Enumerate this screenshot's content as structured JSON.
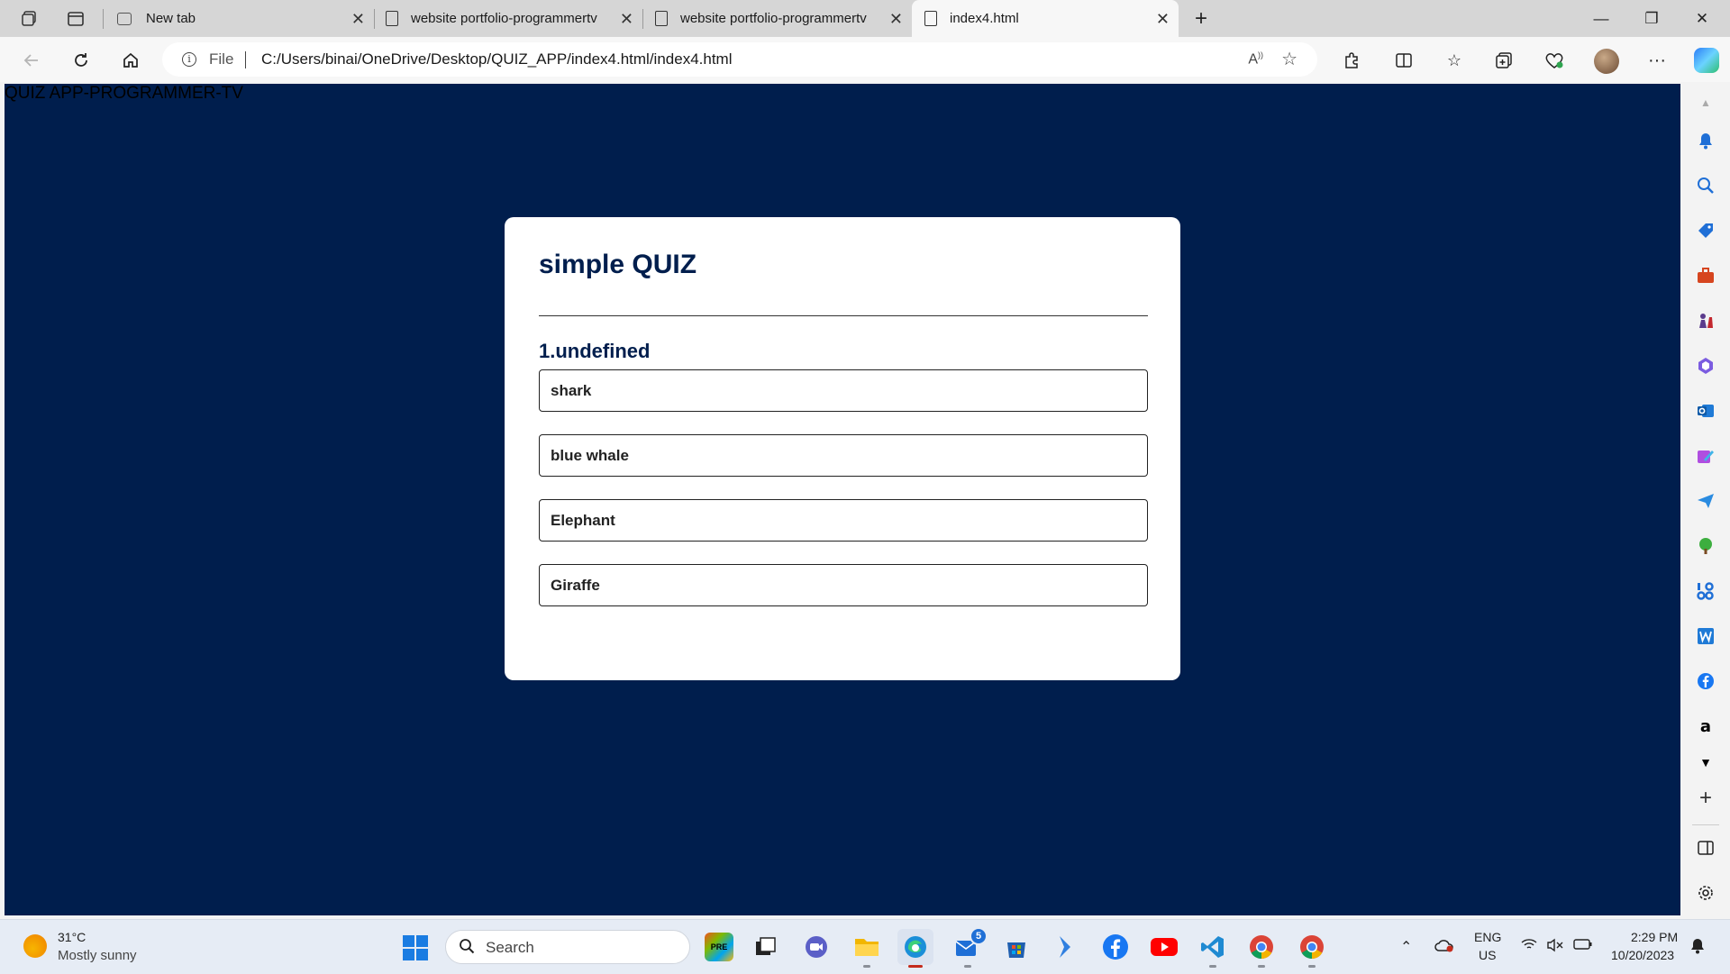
{
  "browser": {
    "tabs": [
      {
        "label": "New tab",
        "kind": "newtab",
        "active": false
      },
      {
        "label": "website portfolio-programmertv",
        "kind": "page",
        "active": false
      },
      {
        "label": "website portfolio-programmertv",
        "kind": "page",
        "active": false
      },
      {
        "label": "index4.html",
        "kind": "page",
        "active": true
      }
    ],
    "new_tab_symbol": "+",
    "window_controls": {
      "minimize": "—",
      "restore": "❐",
      "close": "✕"
    },
    "address": {
      "scheme": "File",
      "url": "C:/Users/binai/OneDrive/Desktop/QUIZ_APP/index4.html/index4.html"
    }
  },
  "page": {
    "header_text": "QUIZ APP-PROGRAMMER-TV",
    "background_color": "#001e4d",
    "quiz": {
      "title": "simple QUIZ",
      "question": "1.undefined",
      "answers": [
        "shark",
        "blue whale",
        "Elephant",
        "Giraffe"
      ]
    }
  },
  "taskbar": {
    "weather": {
      "temp": "31°C",
      "condition": "Mostly sunny"
    },
    "search_placeholder": "Search",
    "apps": [
      "copilot-preview",
      "task-view",
      "teams-chat",
      "file-explorer",
      "edge",
      "mail",
      "microsoft-store",
      "visual-studio",
      "facebook",
      "youtube",
      "vscode",
      "chrome",
      "chrome-profile"
    ],
    "mail_badge": "5",
    "language": {
      "line1": "ENG",
      "line2": "US"
    },
    "clock": {
      "time": "2:29 PM",
      "date": "10/20/2023"
    }
  }
}
